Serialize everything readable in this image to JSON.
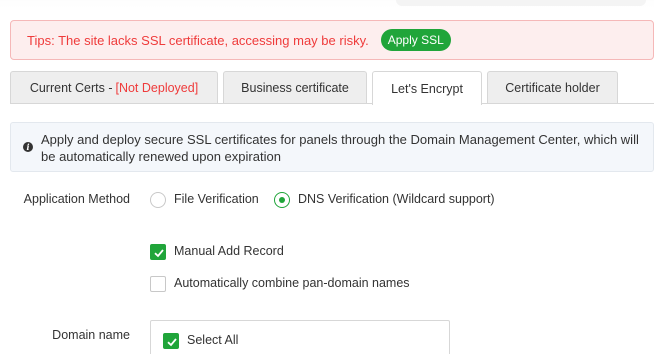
{
  "tip": {
    "text": "Tips: The site lacks SSL certificate, accessing may be risky.",
    "button": "Apply SSL"
  },
  "tabs": [
    {
      "label": "Current Certs -",
      "status": "[Not Deployed]",
      "active": false
    },
    {
      "label": "Business certificate",
      "active": false
    },
    {
      "label": "Let's Encrypt",
      "active": true
    },
    {
      "label": "Certificate holder",
      "active": false
    }
  ],
  "info": {
    "text": "Apply and deploy secure SSL certificates for panels through the Domain Management Center, which will be automatically renewed upon expiration"
  },
  "form": {
    "method_label": "Application Method",
    "methods": [
      {
        "label": "File Verification",
        "checked": false
      },
      {
        "label": "DNS Verification (Wildcard support)",
        "checked": true
      }
    ],
    "manual_add_record": {
      "label": "Manual Add Record",
      "checked": true
    },
    "combine_pan_domain": {
      "label": "Automatically combine pan-domain names",
      "checked": false
    },
    "domain_label": "Domain name",
    "select_all": {
      "label": "Select All",
      "checked": true
    }
  },
  "colors": {
    "accent_green": "#20a53a",
    "alert_red": "#ef3b3b",
    "alert_bg": "#fdeeee"
  }
}
